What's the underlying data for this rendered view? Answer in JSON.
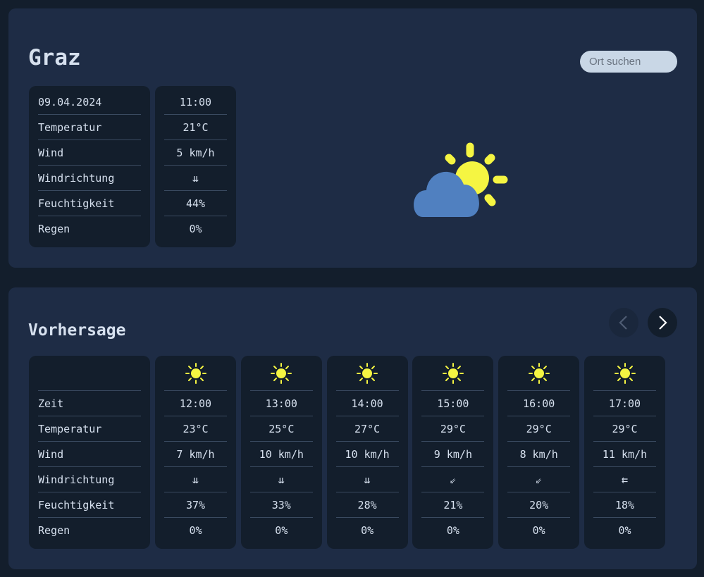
{
  "current": {
    "city": "Graz",
    "search_placeholder": "Ort suchen",
    "labels": [
      "09.04.2024",
      "Temperatur",
      "Wind",
      "Windrichtung",
      "Feuchtigkeit",
      "Regen"
    ],
    "values": [
      "11:00",
      "21°C",
      "5 km/h",
      "⇊",
      "44%",
      "0%"
    ],
    "icon": "partly-cloudy-icon"
  },
  "forecast": {
    "title": "Vorhersage",
    "labels": [
      "Zeit",
      "Temperatur",
      "Wind",
      "Windrichtung",
      "Feuchtigkeit",
      "Regen"
    ],
    "icon": "sun-icon",
    "columns": [
      {
        "time": "12:00",
        "temp": "23°C",
        "wind": "7 km/h",
        "dir": "⇊",
        "humidity": "37%",
        "rain": "0%"
      },
      {
        "time": "13:00",
        "temp": "25°C",
        "wind": "10 km/h",
        "dir": "⇊",
        "humidity": "33%",
        "rain": "0%"
      },
      {
        "time": "14:00",
        "temp": "27°C",
        "wind": "10 km/h",
        "dir": "⇊",
        "humidity": "28%",
        "rain": "0%"
      },
      {
        "time": "15:00",
        "temp": "29°C",
        "wind": "9 km/h",
        "dir": "⇙",
        "humidity": "21%",
        "rain": "0%"
      },
      {
        "time": "16:00",
        "temp": "29°C",
        "wind": "8 km/h",
        "dir": "⇙",
        "humidity": "20%",
        "rain": "0%"
      },
      {
        "time": "17:00",
        "temp": "29°C",
        "wind": "11 km/h",
        "dir": "⇇",
        "humidity": "18%",
        "rain": "0%"
      }
    ]
  },
  "colors": {
    "background": "#131e2c",
    "panel": "#1e2c45",
    "card": "#131e2c",
    "sun": "#f5f542",
    "cloud": "#5080c0"
  }
}
